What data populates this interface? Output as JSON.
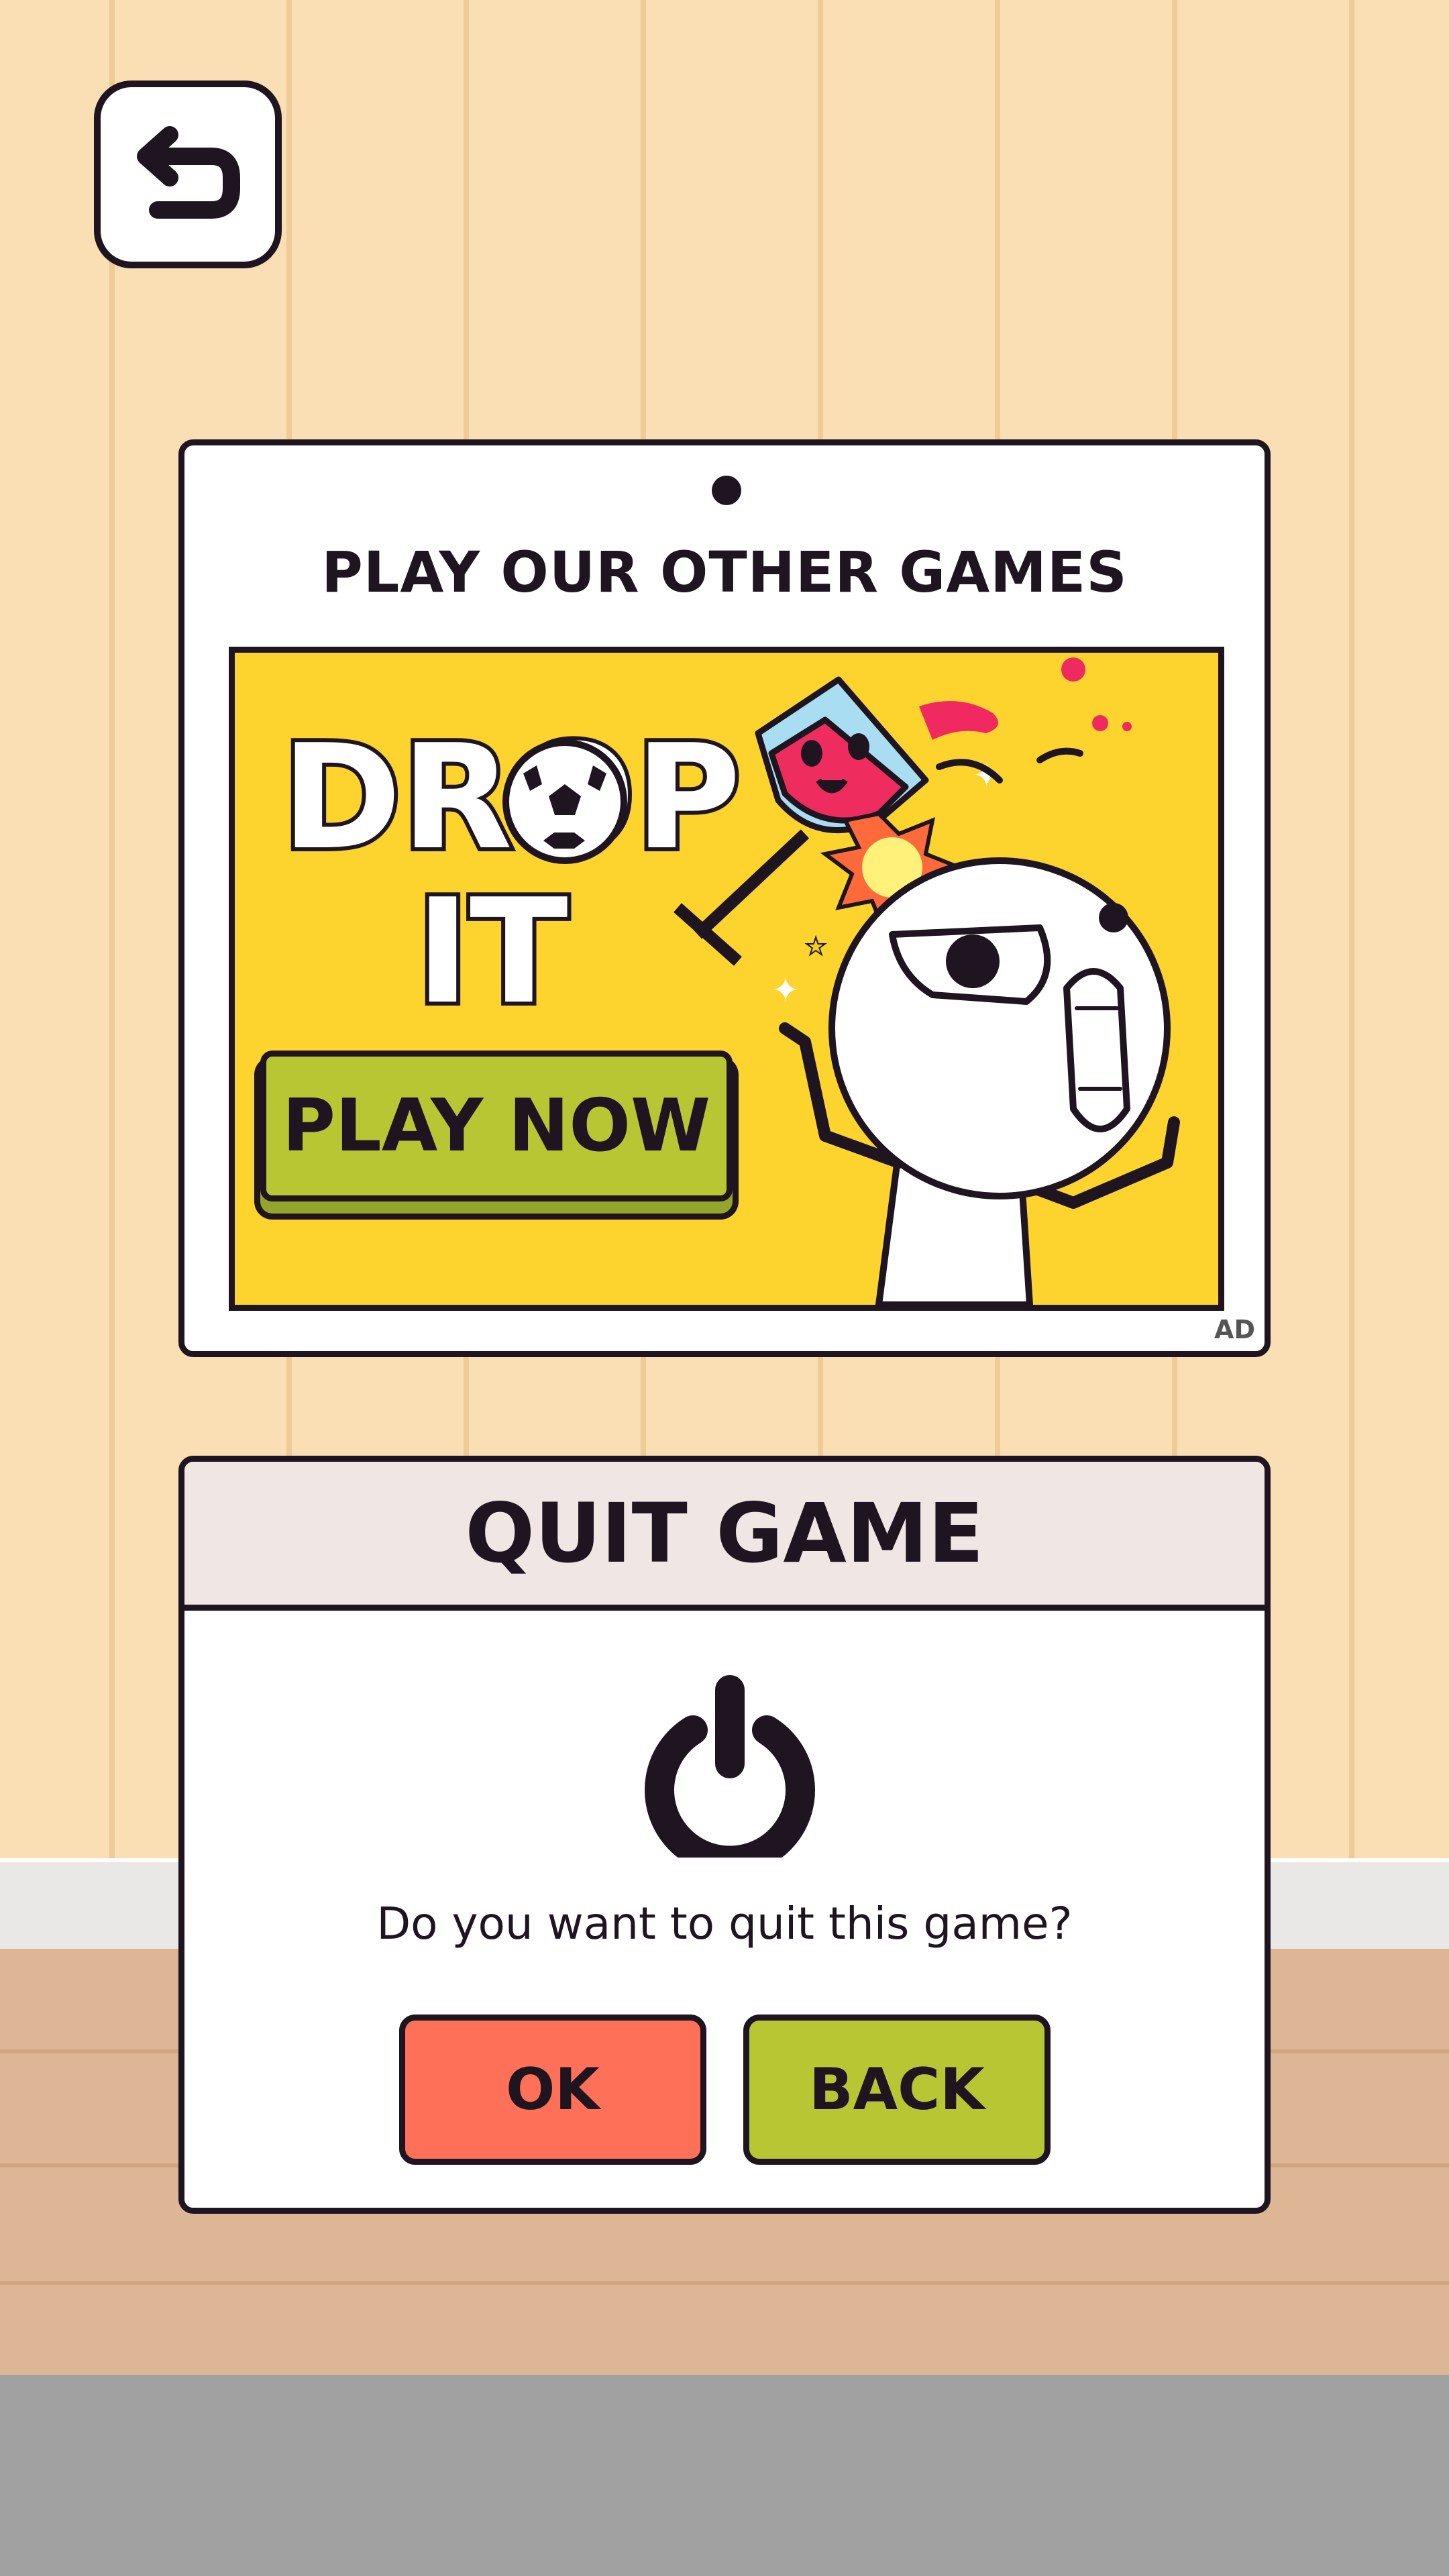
{
  "screen": {
    "back_button_icon": "undo-arrow-icon",
    "colors": {
      "wall": "#F9DFB3",
      "floor": "#DDB795",
      "ok_button": "#FF7058",
      "back_button": "#B7C734",
      "ad_background": "#FDD42D",
      "outline": "#1E1520"
    }
  },
  "ad": {
    "title": "PLAY OUR OTHER GAMES",
    "game_title_line1": "DROP",
    "game_title_line2": "IT",
    "cta_label": "PLAY NOW",
    "badge": "AD"
  },
  "dialog": {
    "title": "QUIT GAME",
    "icon": "power-icon",
    "message": "Do you want to quit this game?",
    "ok_label": "OK",
    "back_label": "BACK"
  }
}
